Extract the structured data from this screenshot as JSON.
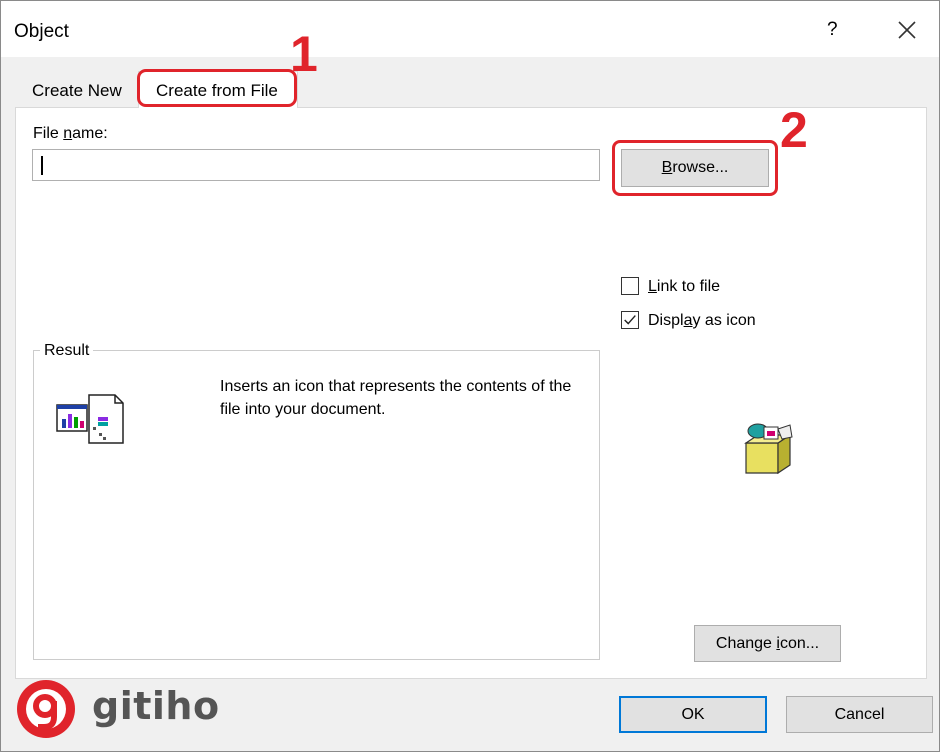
{
  "window": {
    "title": "Object",
    "help_label": "?"
  },
  "tabs": [
    {
      "label": "Create New",
      "selected": false
    },
    {
      "label": "Create from File",
      "selected": true
    }
  ],
  "file_name": {
    "label": "File name:",
    "value": ""
  },
  "browse_label": "Browse...",
  "checkboxes": [
    {
      "label": "Link to file",
      "checked": false
    },
    {
      "label": "Display as icon",
      "checked": true
    }
  ],
  "result": {
    "legend": "Result",
    "text": "Inserts an icon that represents the contents of the file into your document."
  },
  "change_icon_label": "Change icon...",
  "buttons": {
    "ok": "OK",
    "cancel": "Cancel"
  },
  "annotations": {
    "step1": "1",
    "step2": "2",
    "highlight_color": "#e0242b"
  },
  "watermark": {
    "text": "gitiho",
    "brand_color": "#e0242b"
  },
  "icons": [
    "close-icon",
    "document-object-icon",
    "package-icon",
    "gitiho-logo-icon"
  ]
}
